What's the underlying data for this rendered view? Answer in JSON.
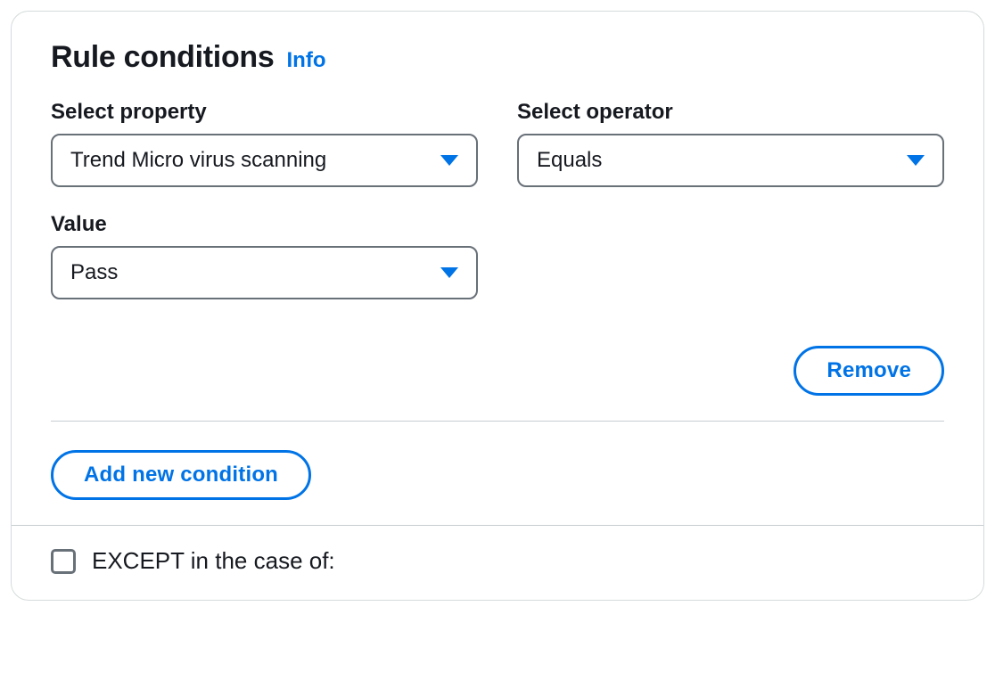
{
  "panel": {
    "title": "Rule conditions",
    "info_link": "Info"
  },
  "form": {
    "property": {
      "label": "Select property",
      "value": "Trend Micro virus scanning"
    },
    "operator": {
      "label": "Select operator",
      "value": "Equals"
    },
    "value": {
      "label": "Value",
      "value": "Pass"
    }
  },
  "buttons": {
    "remove": "Remove",
    "add_condition": "Add new condition"
  },
  "except": {
    "label": "EXCEPT in the case of:"
  }
}
